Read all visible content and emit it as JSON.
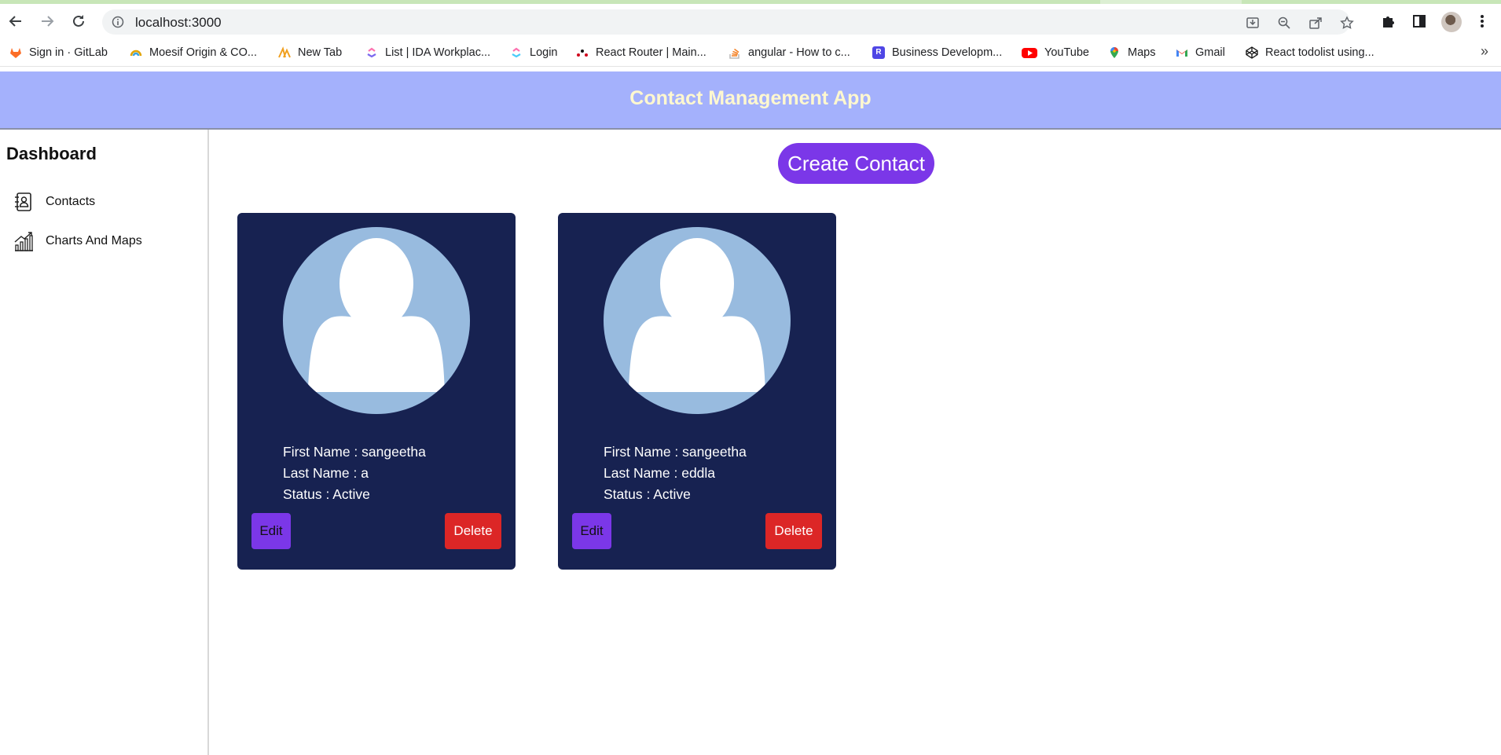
{
  "browser": {
    "url": "localhost:3000",
    "bookmarks": [
      {
        "label": "Sign in · GitLab",
        "icon": "gitlab-icon",
        "color": "#fc6d26"
      },
      {
        "label": "Moesif Origin & CO...",
        "icon": "moesif-icon",
        "color": "#e0a300"
      },
      {
        "label": "New Tab",
        "icon": "pma-icon",
        "color": "#f0a020"
      },
      {
        "label": "List | IDA Workplac...",
        "icon": "clickup-icon",
        "color": "#7b68ee"
      },
      {
        "label": "Login",
        "icon": "clickup-icon",
        "color": "#fd71af"
      },
      {
        "label": "React Router | Main...",
        "icon": "react-router-icon",
        "color": "#d0021b"
      },
      {
        "label": "angular - How to c...",
        "icon": "stackoverflow-icon",
        "color": "#f48024"
      },
      {
        "label": "Business Developm...",
        "icon": "r-badge-icon",
        "color": "#4f46e5"
      },
      {
        "label": "YouTube",
        "icon": "youtube-icon",
        "color": "#ff0000"
      },
      {
        "label": "Maps",
        "icon": "maps-icon",
        "color": "#34a853"
      },
      {
        "label": "Gmail",
        "icon": "gmail-icon",
        "color": "#ea4335"
      },
      {
        "label": "React todolist using...",
        "icon": "codepen-icon",
        "color": "#111111"
      }
    ],
    "bookmarks_more": "»"
  },
  "app": {
    "title": "Contact Management App",
    "colors": {
      "header": "#a4b1fc",
      "title": "#fff8cf",
      "accent": "#7b37e8",
      "card": "#172251",
      "danger": "#dc2626",
      "avatar": "#98bbdf"
    }
  },
  "sidebar": {
    "heading": "Dashboard",
    "items": [
      {
        "label": "Contacts",
        "icon": "contacts-book-icon"
      },
      {
        "label": "Charts And Maps",
        "icon": "chart-growth-icon"
      }
    ]
  },
  "main": {
    "create_label": "Create Contact",
    "contacts": [
      {
        "first": "First Name : sangeetha",
        "last": "Last Name : a",
        "status": "Status : Active",
        "edit": "Edit",
        "delete": "Delete"
      },
      {
        "first": "First Name : sangeetha",
        "last": "Last Name : eddla",
        "status": "Status : Active",
        "edit": "Edit",
        "delete": "Delete"
      }
    ]
  }
}
